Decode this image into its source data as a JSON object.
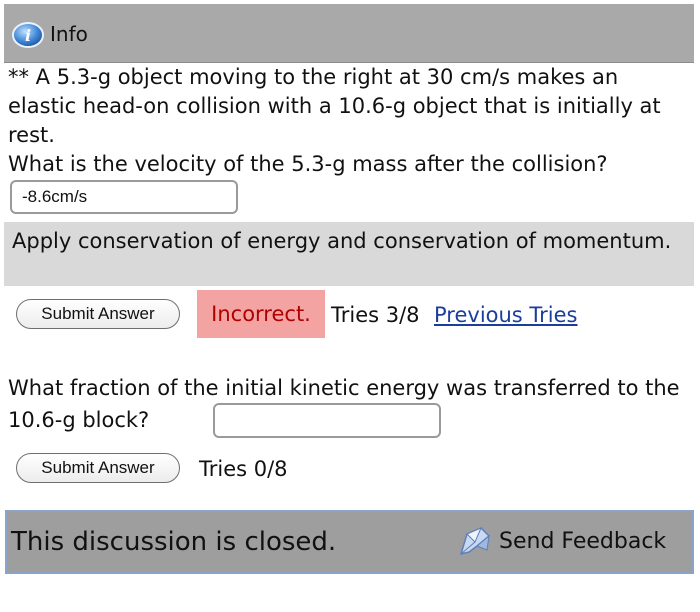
{
  "info": {
    "icon": "info-icon",
    "label": "Info"
  },
  "problem": {
    "statement": "** A 5.3-g object moving to the right at 30 cm/s makes an elastic head-on collision with a 10.6-g object that is initially at rest.",
    "question1": "What is the velocity of the 5.3-g mass after the collision?",
    "answer1_value": "-8.6cm/s",
    "hint": "Apply conservation of energy and conservation of momentum.",
    "submit_label": "Submit Answer",
    "result": "Incorrect.",
    "tries1": "Tries 3/8",
    "previous_tries": "Previous Tries",
    "question2": "What fraction of the initial kinetic energy was transferred to the 10.6-g block?",
    "answer2_value": "",
    "tries2": "Tries 0/8"
  },
  "footer": {
    "closed": "This discussion is closed.",
    "feedback_icon": "feedback-icon",
    "feedback": "Send Feedback"
  },
  "colors": {
    "info_bar": "#a9a9a9",
    "hint_bg": "#d9d9d9",
    "incorrect_bg": "#f4a3a3",
    "incorrect_text": "#b00000",
    "link": "#1a3e9c",
    "footer_bg": "#9e9e9e"
  }
}
